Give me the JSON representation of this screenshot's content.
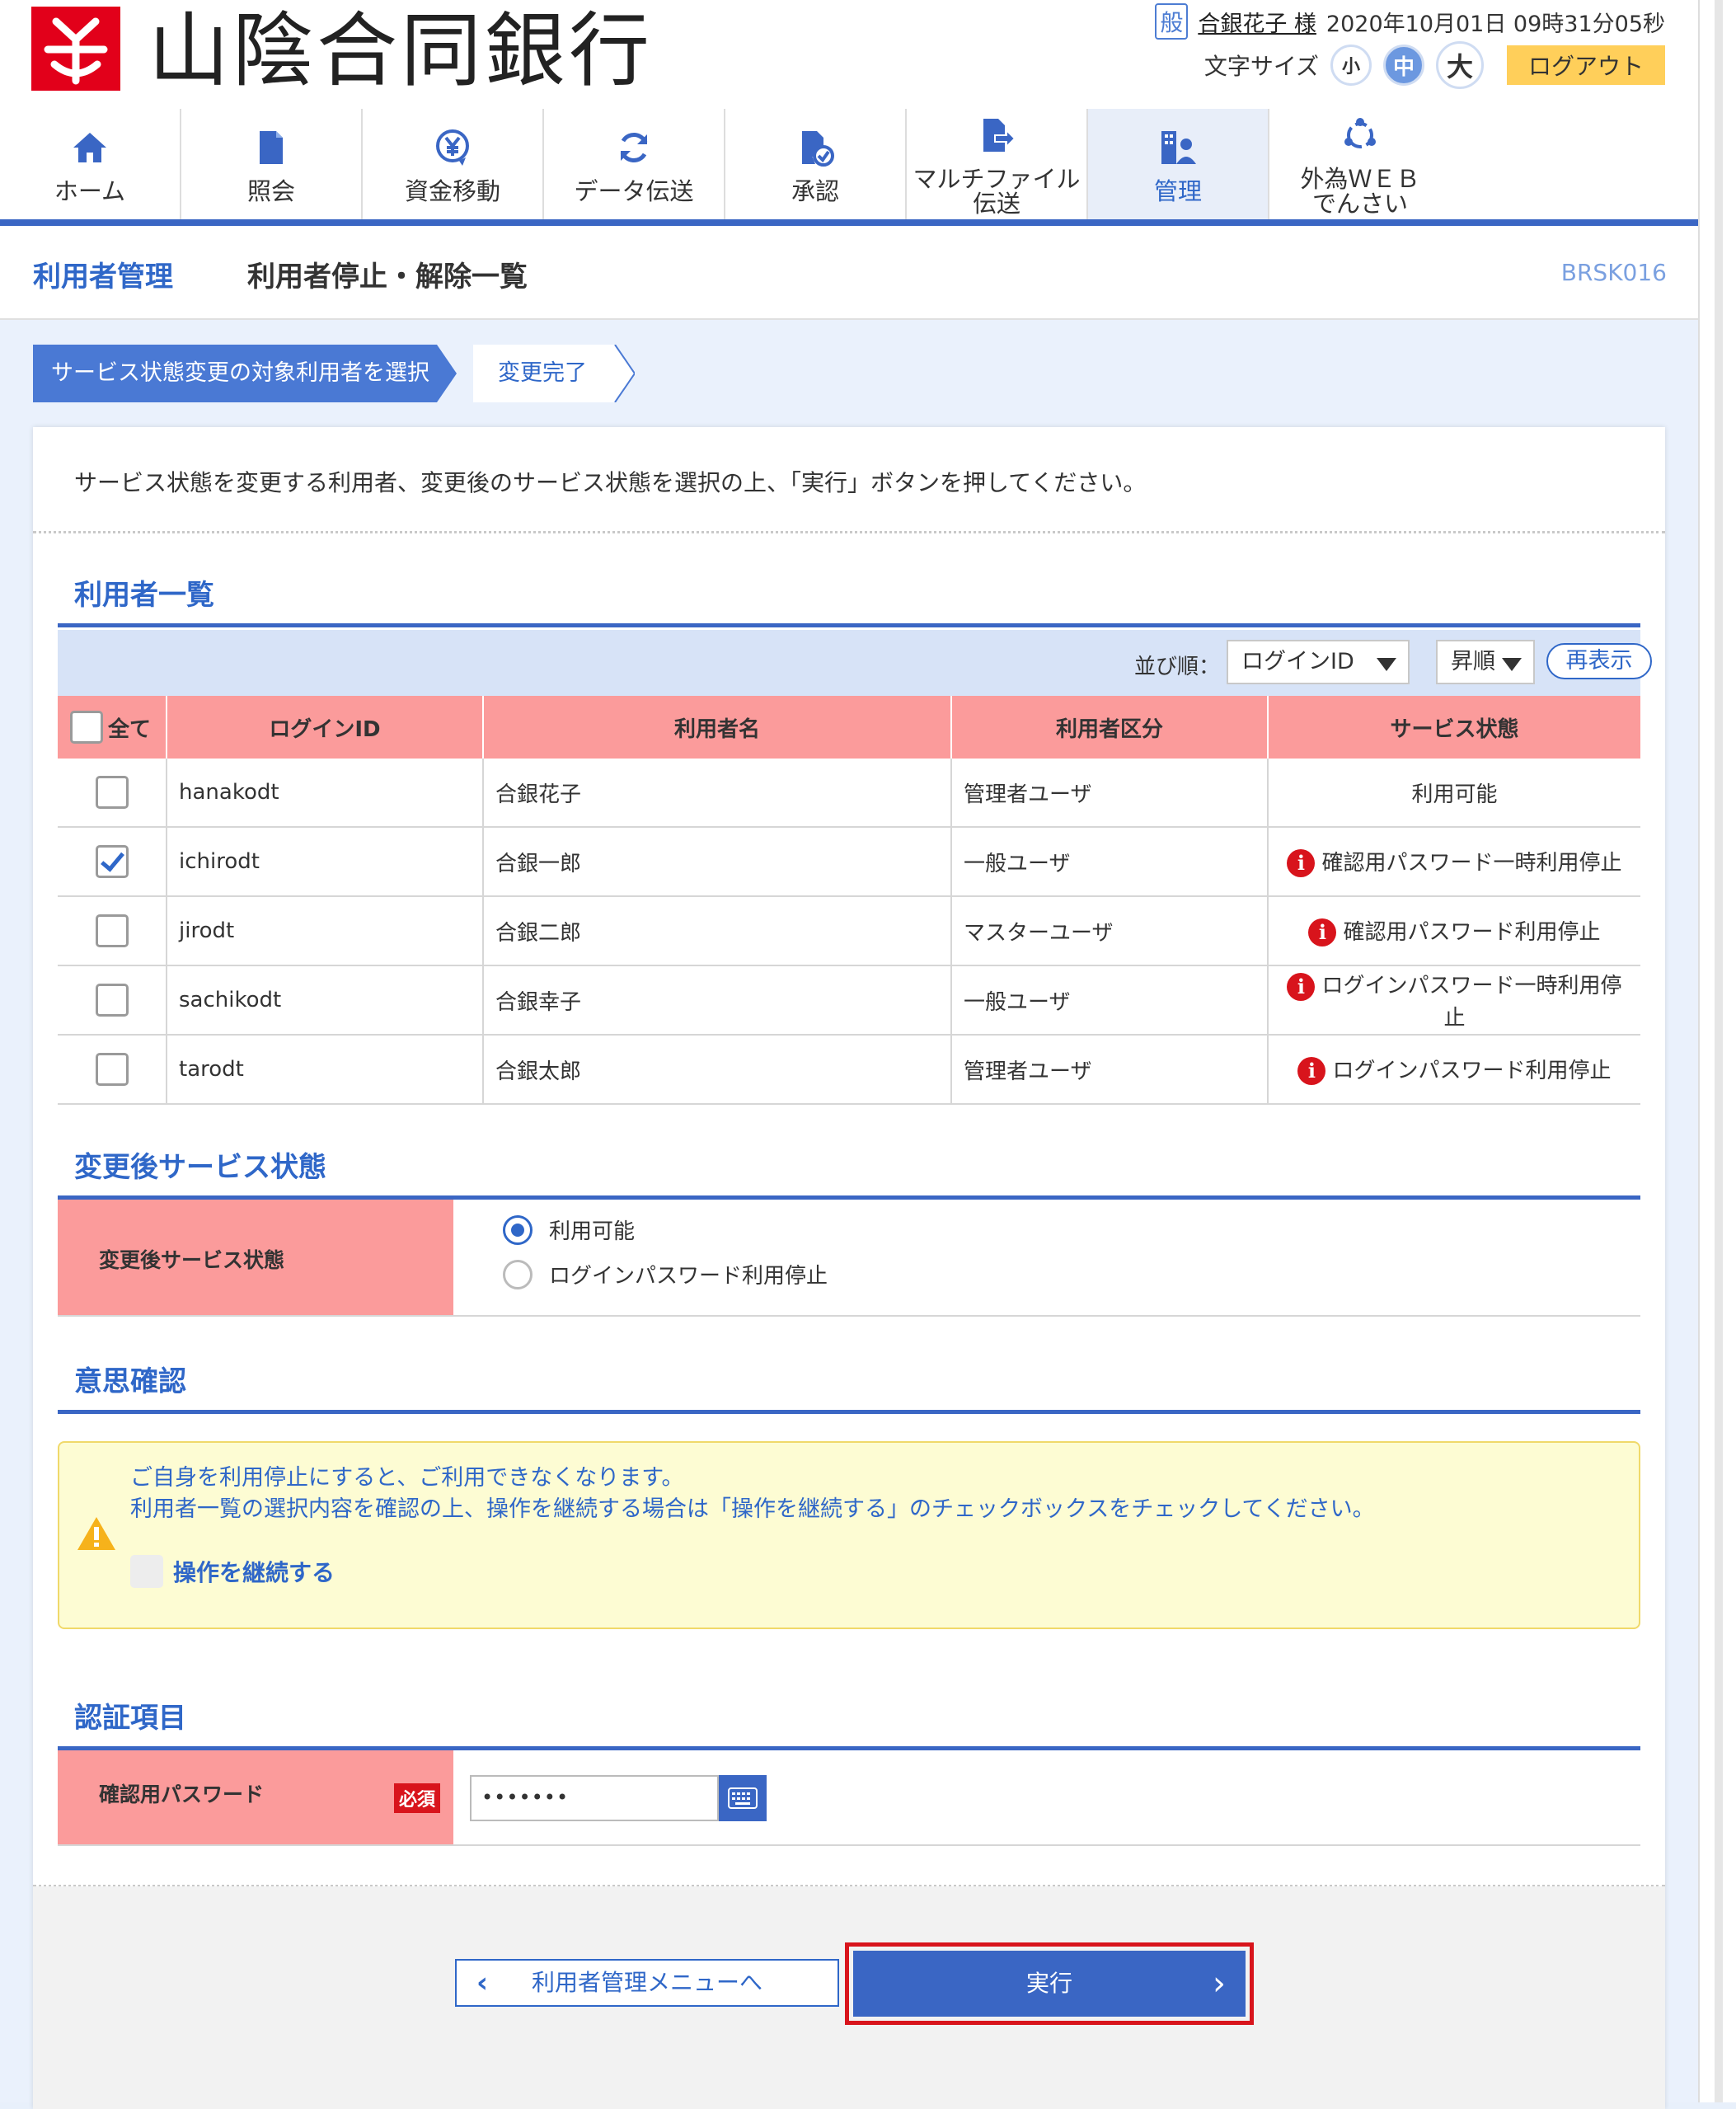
{
  "header": {
    "bank_name": "山陰合同銀行",
    "user_badge": "般",
    "user_name": "合銀花子 様",
    "datetime": "2020年10月01日 09時31分05秒",
    "font_size_label": "文字サイズ",
    "font_sizes": [
      "小",
      "中",
      "大"
    ],
    "logout": "ログアウト"
  },
  "nav": [
    {
      "label": "ホーム",
      "icon": "home-icon"
    },
    {
      "label": "照会",
      "icon": "document-icon"
    },
    {
      "label": "資金移動",
      "icon": "yen-icon"
    },
    {
      "label": "データ伝送",
      "icon": "sync-icon"
    },
    {
      "label": "承認",
      "icon": "approve-icon"
    },
    {
      "label": "マルチファイル\n伝送",
      "line1": "マルチファイル",
      "line2": "伝送",
      "icon": "file-transfer-icon"
    },
    {
      "label": "管理",
      "icon": "admin-icon"
    },
    {
      "label": "外為ＷＥＢ\nでんさい",
      "line1": "外為ＷＥＢ",
      "line2": "でんさい",
      "icon": "forex-icon"
    }
  ],
  "title": {
    "category": "利用者管理",
    "page": "利用者停止・解除一覧",
    "screen_id": "BRSK016"
  },
  "steps": [
    "サービス状態変更の対象利用者を選択",
    "変更完了"
  ],
  "intro": "サービス状態を変更する利用者、変更後のサービス状態を選択の上、「実行」ボタンを押してください。",
  "user_list": {
    "title": "利用者一覧",
    "sort_label": "並び順：",
    "sort_field": "ログインID",
    "sort_order": "昇順",
    "refresh": "再表示",
    "headers": [
      "全て",
      "ログインID",
      "利用者名",
      "利用者区分",
      "サービス状態"
    ],
    "rows": [
      {
        "login_id": "hanakodt",
        "name": "合銀花子",
        "type": "管理者ユーザ",
        "status": "利用可能",
        "checked": false,
        "warn": false
      },
      {
        "login_id": "ichirodt",
        "name": "合銀一郎",
        "type": "一般ユーザ",
        "status": "確認用パスワード一時利用停止",
        "checked": true,
        "warn": true
      },
      {
        "login_id": "jirodt",
        "name": "合銀二郎",
        "type": "マスターユーザ",
        "status": "確認用パスワード利用停止",
        "checked": false,
        "warn": true
      },
      {
        "login_id": "sachikodt",
        "name": "合銀幸子",
        "type": "一般ユーザ",
        "status": "ログインパスワード一時利用停止",
        "checked": false,
        "warn": true
      },
      {
        "login_id": "tarodt",
        "name": "合銀太郎",
        "type": "管理者ユーザ",
        "status": "ログインパスワード利用停止",
        "checked": false,
        "warn": true
      }
    ]
  },
  "after_status": {
    "title": "変更後サービス状態",
    "label": "変更後サービス状態",
    "options": [
      "利用可能",
      "ログインパスワード利用停止"
    ],
    "selected": 0
  },
  "confirm": {
    "title": "意思確認",
    "line1": "ご自身を利用停止にすると、ご利用できなくなります。",
    "line2": "利用者一覧の選択内容を確認の上、操作を継続する場合は「操作を継続する」のチェックボックスをチェックしてください。",
    "checkbox": "操作を継続する"
  },
  "auth": {
    "title": "認証項目",
    "label": "確認用パスワード",
    "required": "必須",
    "password_value": "•••••••"
  },
  "buttons": {
    "back": "利用者管理メニューへ",
    "execute": "実行"
  },
  "colors": {
    "primary": "#3a66c4",
    "header_red": "#fb9b9b",
    "brand_red": "#e2001a",
    "warn_bg": "#fdfcd3"
  }
}
